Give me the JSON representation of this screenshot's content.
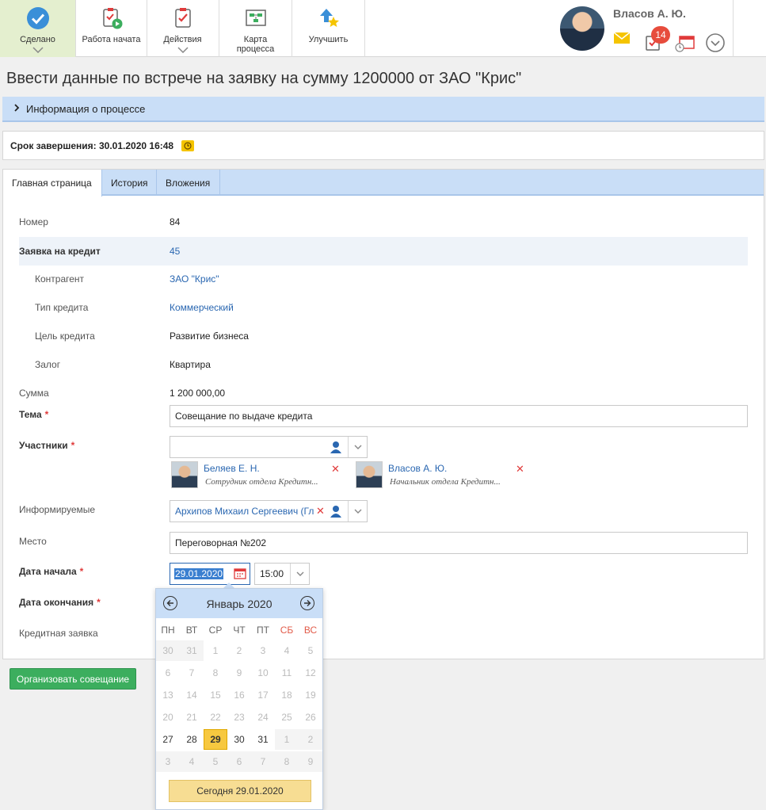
{
  "toolbar": {
    "done": "Сделано",
    "work_started": "Работа начата",
    "actions": "Действия",
    "process_map_line1": "Карта",
    "process_map_line2": "процесса",
    "improve": "Улучшить"
  },
  "user": {
    "name": "Власов А. Ю.",
    "task_count": "14"
  },
  "page_title": "Ввести данные по встрече на заявку на сумму 1200000 от ЗАО \"Крис\"",
  "process_info": "Информация о процессе",
  "deadline": "Срок завершения: 30.01.2020 16:48",
  "tabs": [
    "Главная страница",
    "История",
    "Вложения"
  ],
  "fields": {
    "number_label": "Номер",
    "number_value": "84",
    "credit_app_label": "Заявка на кредит",
    "credit_app_value": "45",
    "counterparty_label": "Контрагент",
    "counterparty_value": "ЗАО \"Крис\"",
    "credit_type_label": "Тип кредита",
    "credit_type_value": "Коммерческий",
    "credit_goal_label": "Цель кредита",
    "credit_goal_value": "Развитие бизнеса",
    "collateral_label": "Залог",
    "collateral_value": "Квартира",
    "sum_label": "Сумма",
    "sum_value": "1 200 000,00",
    "topic_label": "Тема",
    "topic_value": "Совещание по выдаче кредита",
    "participants_label": "Участники",
    "informed_label": "Информируемые",
    "informed_value": "Архипов Михаил Сергеевич (Гл",
    "place_label": "Место",
    "place_value": "Переговорная №202",
    "start_date_label": "Дата начала",
    "start_date_value": "29.01.2020",
    "start_time_value": "15:00",
    "end_date_label": "Дата окончания",
    "credit_request_label": "Кредитная заявка"
  },
  "participants": [
    {
      "name": "Беляев Е. Н.",
      "position": "Сотрудник отдела Кредитн..."
    },
    {
      "name": "Власов А. Ю.",
      "position": "Начальник отдела Кредитн..."
    }
  ],
  "organize_button": "Организовать совещание",
  "calendar": {
    "month_title": "Январь 2020",
    "weekdays": [
      "ПН",
      "ВТ",
      "СР",
      "ЧТ",
      "ПТ",
      "СБ",
      "ВС"
    ],
    "weeks": [
      [
        "30",
        "31",
        "1",
        "2",
        "3",
        "4",
        "5"
      ],
      [
        "6",
        "7",
        "8",
        "9",
        "10",
        "11",
        "12"
      ],
      [
        "13",
        "14",
        "15",
        "16",
        "17",
        "18",
        "19"
      ],
      [
        "20",
        "21",
        "22",
        "23",
        "24",
        "25",
        "26"
      ],
      [
        "27",
        "28",
        "29",
        "30",
        "31",
        "1",
        "2"
      ],
      [
        "3",
        "4",
        "5",
        "6",
        "7",
        "8",
        "9"
      ]
    ],
    "today_button": "Сегодня 29.01.2020"
  }
}
